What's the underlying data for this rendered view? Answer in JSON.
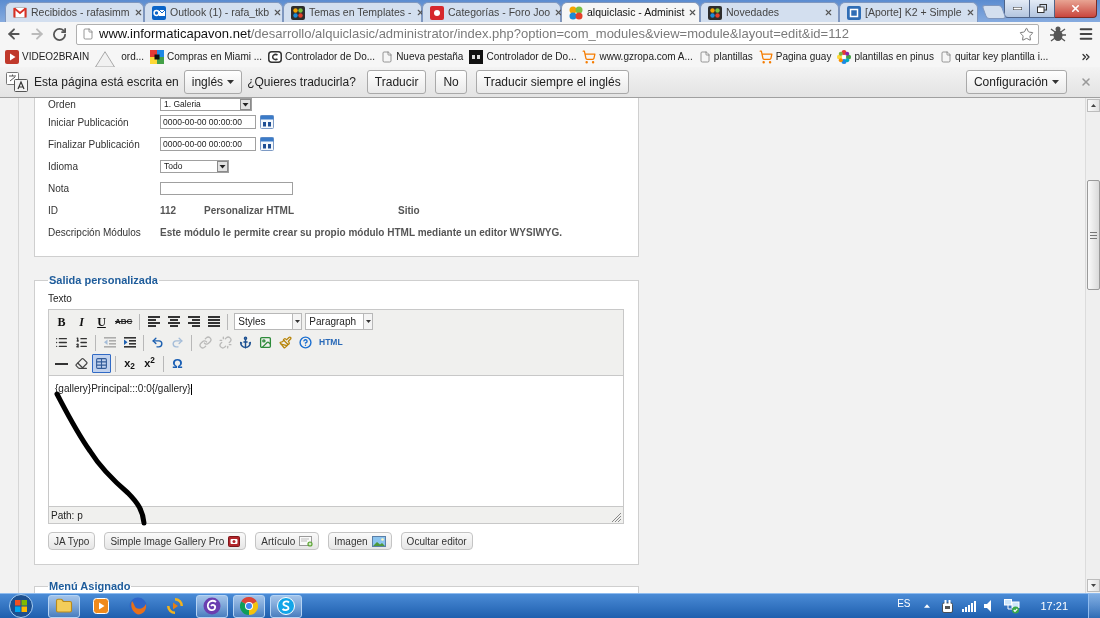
{
  "browser": {
    "tabs": [
      {
        "title": "Recibidos - rafasimm",
        "kind": "mail",
        "selected": false
      },
      {
        "title": "Outlook (1) - rafa_tkb",
        "kind": "outlook",
        "selected": false
      },
      {
        "title": "Temas en Templates -",
        "kind": "dots-tile",
        "selected": false
      },
      {
        "title": "Categorías - Foro Joo",
        "kind": "forum",
        "selected": false
      },
      {
        "title": "alquiclasic - Administ",
        "kind": "petals",
        "selected": true
      },
      {
        "title": "Novedades",
        "kind": "dots-tile",
        "selected": false
      },
      {
        "title": "[Aporte] K2 + Simple",
        "kind": "letter-tile",
        "selected": false
      }
    ],
    "address": {
      "host": "www.informaticapavon.net",
      "path": "/desarrollo/alquiclasic/administrator/index.php?option=com_modules&view=module&layout=edit&id=112"
    },
    "bookmarks": [
      {
        "label": "VIDEO2BRAIN",
        "kind": "video"
      },
      {
        "label": "ord...",
        "kind": "plain"
      },
      {
        "label": "Compras en Miami ...",
        "kind": "grid"
      },
      {
        "label": "Controlador de Do...",
        "kind": "ring"
      },
      {
        "label": "Nueva pestaña",
        "kind": "page"
      },
      {
        "label": "Controlador de Do...",
        "kind": "dark"
      },
      {
        "label": "www.gzropa.com A...",
        "kind": "cart"
      },
      {
        "label": "plantillas",
        "kind": "page"
      },
      {
        "label": "Pagina guay",
        "kind": "cart"
      },
      {
        "label": "plantillas en pinus",
        "kind": "flower"
      },
      {
        "label": "quitar key plantilla i...",
        "kind": "page"
      }
    ]
  },
  "translate_bar": {
    "message": "Esta página está escrita en",
    "language": "inglés",
    "question": "¿Quieres traducirla?",
    "buttons": [
      "Traducir",
      "No",
      "Traducir siempre el inglés"
    ],
    "settings": "Configuración"
  },
  "module_details": {
    "rows": [
      {
        "label": "Orden",
        "kind": "select",
        "value": "1. Galeria"
      },
      {
        "label": "Iniciar Publicación",
        "kind": "date",
        "value": "0000-00-00 00:00:00"
      },
      {
        "label": "Finalizar Publicación",
        "kind": "date",
        "value": "0000-00-00 00:00:00"
      },
      {
        "label": "Idioma",
        "kind": "select",
        "value": "Todo"
      },
      {
        "label": "Nota",
        "kind": "text"
      },
      {
        "label": "ID",
        "kind": "info",
        "values": [
          "112",
          "Personalizar HTML",
          "Sitio"
        ]
      },
      {
        "label": "Descripción Módulos",
        "kind": "info",
        "values": [
          "Este módulo le permite crear su propio módulo HTML mediante un editor WYSIWYG."
        ]
      }
    ]
  },
  "custom_output": {
    "legend": "Salida personalizada",
    "field_label": "Texto",
    "editor": {
      "toolbar": [
        [
          {
            "kind": "bold",
            "label": "B",
            "disabled": false,
            "active": false
          },
          {
            "kind": "italic",
            "label": "I",
            "disabled": false,
            "active": false
          },
          {
            "kind": "underline",
            "label": "U",
            "disabled": false,
            "active": false
          },
          {
            "kind": "strikethrough",
            "label": "ABC",
            "disabled": false,
            "active": false
          },
          {
            "kind": "separator"
          },
          {
            "kind": "align-left",
            "disabled": false,
            "active": false
          },
          {
            "kind": "align-center",
            "disabled": false,
            "active": false
          },
          {
            "kind": "align-right",
            "disabled": false,
            "active": false
          },
          {
            "kind": "align-justify",
            "disabled": false,
            "active": false
          },
          {
            "kind": "separator"
          },
          {
            "kind": "select",
            "value": "Styles"
          },
          {
            "kind": "select",
            "value": "Paragraph"
          }
        ],
        [
          {
            "kind": "bullet-list",
            "disabled": false,
            "active": false
          },
          {
            "kind": "numbered-list",
            "disabled": false,
            "active": false
          },
          {
            "kind": "separator"
          },
          {
            "kind": "outdent",
            "disabled": true,
            "active": false
          },
          {
            "kind": "indent",
            "disabled": false,
            "active": false
          },
          {
            "kind": "separator"
          },
          {
            "kind": "undo",
            "disabled": false,
            "active": false
          },
          {
            "kind": "redo",
            "disabled": true,
            "active": false
          },
          {
            "kind": "separator"
          },
          {
            "kind": "link",
            "disabled": true,
            "active": false
          },
          {
            "kind": "unlink",
            "disabled": true,
            "active": false
          },
          {
            "kind": "anchor",
            "disabled": false,
            "active": false
          },
          {
            "kind": "image",
            "disabled": false,
            "active": false
          },
          {
            "kind": "cleanup",
            "disabled": false,
            "active": false
          },
          {
            "kind": "help",
            "disabled": false,
            "active": false
          },
          {
            "kind": "html",
            "label": "HTML",
            "disabled": false,
            "active": false
          }
        ],
        [
          {
            "kind": "horizontal-rule",
            "disabled": false,
            "active": false
          },
          {
            "kind": "eraser",
            "disabled": false,
            "active": false
          },
          {
            "kind": "table",
            "disabled": false,
            "active": true
          },
          {
            "kind": "separator"
          },
          {
            "kind": "subscript",
            "label": "x$_{2}$",
            "disabled": false,
            "active": false
          },
          {
            "kind": "superscript",
            "label": "x$^{2}$",
            "disabled": false,
            "active": false
          },
          {
            "kind": "separator"
          },
          {
            "kind": "special-char",
            "label": "Ω",
            "disabled": false,
            "active": false
          }
        ]
      ],
      "content": "{gallery}Principal:::0:0{/gallery}",
      "path": "Path: p"
    },
    "buttons": [
      {
        "label": "JA Typo",
        "kind": "plain"
      },
      {
        "label": "Simple Image Gallery Pro",
        "kind": "gallery"
      },
      {
        "label": "Artículo",
        "kind": "article"
      },
      {
        "label": "Imagen",
        "kind": "image"
      },
      {
        "label": "Ocultar editor",
        "kind": "plain"
      }
    ]
  },
  "assigned_menu": {
    "legend": "Menú Asignado"
  },
  "taskbar": {
    "apps": [
      {
        "kind": "folder",
        "open": true
      },
      {
        "kind": "media",
        "open": false
      },
      {
        "kind": "globe",
        "open": false
      },
      {
        "kind": "sync-play",
        "open": false
      },
      {
        "kind": "swirl",
        "open": true
      },
      {
        "kind": "segmented",
        "open": true
      },
      {
        "kind": "chat",
        "open": true
      }
    ],
    "language": "ES",
    "clock": "17:21"
  }
}
